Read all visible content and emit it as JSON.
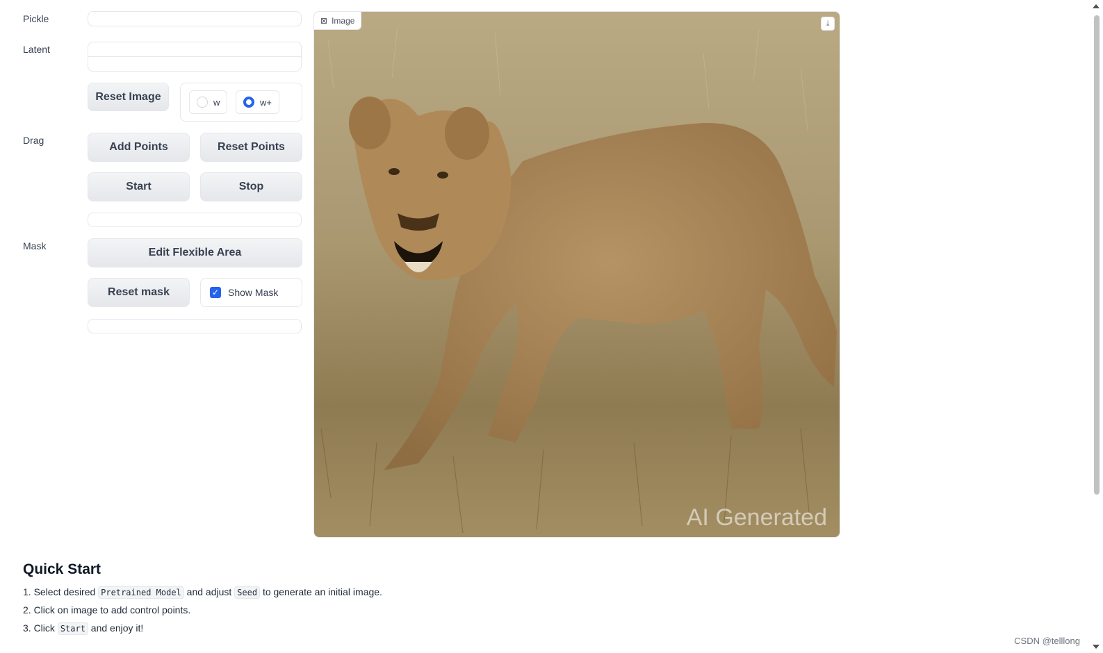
{
  "labels": {
    "pickle": "Pickle",
    "latent": "Latent",
    "drag": "Drag",
    "mask": "Mask"
  },
  "buttons": {
    "reset_image": "Reset Image",
    "add_points": "Add Points",
    "reset_points": "Reset Points",
    "start": "Start",
    "stop": "Stop",
    "edit_flexible_area": "Edit Flexible Area",
    "reset_mask": "Reset mask"
  },
  "latent_radio": {
    "options": [
      "w",
      "w+"
    ],
    "selected": "w+"
  },
  "show_mask": {
    "label": "Show Mask",
    "checked": true
  },
  "image_panel": {
    "tag": "Image",
    "tag_icon": "image-icon",
    "download_icon": "download-icon",
    "watermark": "AI Generated"
  },
  "quick_start": {
    "title": "Quick Start",
    "step1": {
      "a": "1. Select desired ",
      "code1": "Pretrained Model",
      "b": " and adjust ",
      "code2": "Seed",
      "c": " to generate an initial image."
    },
    "step2": "2. Click on image to add control points.",
    "step3": {
      "a": "3. Click ",
      "code": "Start",
      "b": " and enjoy it!"
    }
  },
  "footer": {
    "credit": "CSDN @telllong"
  },
  "colors": {
    "accent": "#2563eb",
    "button_bg": "#e5e7eb",
    "border": "#e5e7eb"
  }
}
